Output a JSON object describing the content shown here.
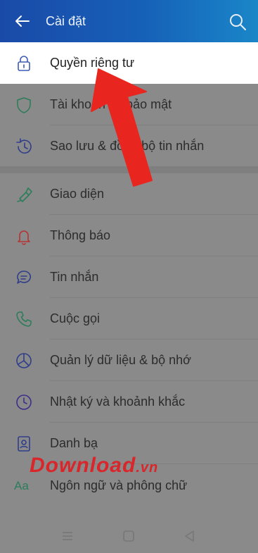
{
  "header": {
    "title": "Cài đặt",
    "back_icon": "arrow-left-icon",
    "search_icon": "search-icon"
  },
  "settings": {
    "items": [
      {
        "label": "Quyền riêng tư",
        "icon": "lock-icon"
      },
      {
        "label": "Tài khoản và bảo mật",
        "icon": "shield-icon"
      },
      {
        "label": "Sao lưu & đồng bộ tin nhắn",
        "icon": "history-icon"
      },
      {
        "label": "Giao diện",
        "icon": "brush-icon"
      },
      {
        "label": "Thông báo",
        "icon": "bell-icon"
      },
      {
        "label": "Tin nhắn",
        "icon": "chat-icon"
      },
      {
        "label": "Cuộc gọi",
        "icon": "phone-icon"
      },
      {
        "label": "Quản lý dữ liệu & bộ nhớ",
        "icon": "pie-chart-icon"
      },
      {
        "label": "Nhật ký và khoảnh khắc",
        "icon": "clock-icon"
      },
      {
        "label": "Danh bạ",
        "icon": "contact-icon"
      },
      {
        "label": "Ngôn ngữ và phông chữ",
        "icon": "language-icon"
      }
    ]
  },
  "watermark": {
    "main": "Download",
    "tld": ".vn"
  },
  "colors": {
    "header_start": "#1a4aa8",
    "header_end": "#1a86c8",
    "arrow": "#e8261f",
    "dim_overlay": "#8a8a8a",
    "active_row": "#ffffff"
  }
}
